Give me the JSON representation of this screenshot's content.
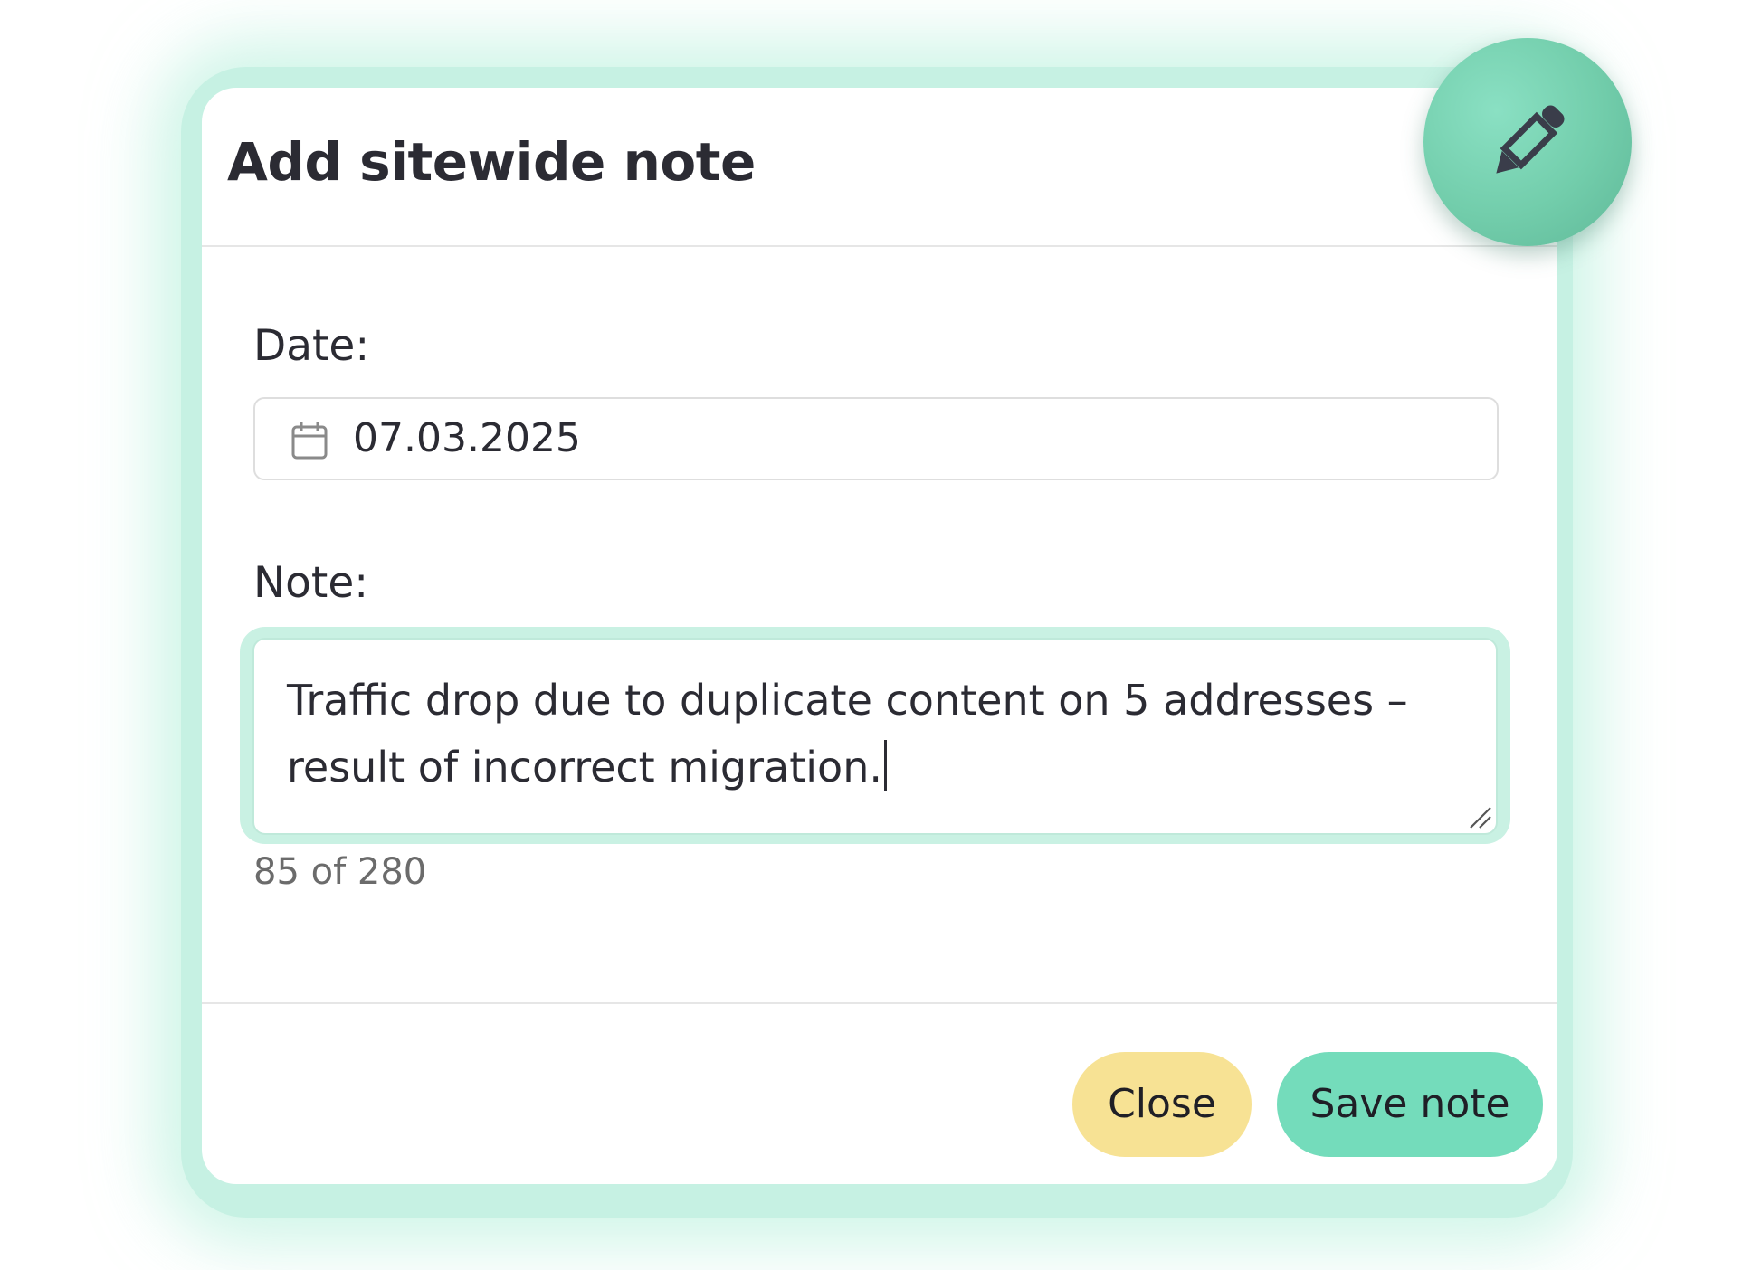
{
  "modal": {
    "title": "Add sitewide note"
  },
  "date_field": {
    "label": "Date:",
    "value": "07.03.2025",
    "icon": "calendar-icon"
  },
  "note_field": {
    "label": "Note:",
    "value": "Traffic drop due to duplicate content on 5 addresses – result of incorrect migration.",
    "counter": "85 of 280"
  },
  "footer": {
    "close_label": "Close",
    "save_label": "Save note"
  },
  "fab": {
    "icon": "pencil-icon"
  },
  "colors": {
    "accent": "#74dcbb",
    "glow": "#c6f1e3",
    "close_button": "#f7e294",
    "text": "#2b2b33"
  }
}
